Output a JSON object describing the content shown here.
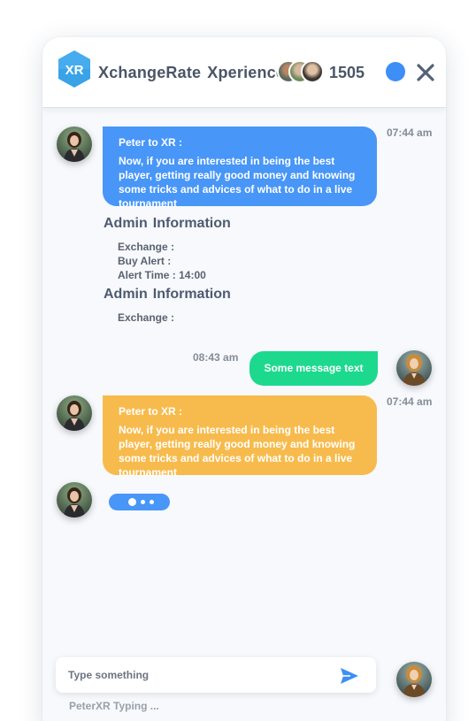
{
  "header": {
    "brand_word1": "XchangeRate",
    "brand_word2": "Xperience",
    "logo_text": "XR",
    "participant_count": "1505"
  },
  "messages": [
    {
      "sender": "Peter to XR :",
      "text": "Now, if you are interested in being the best player, getting really good money and knowing some tricks and advices of what to do in a live tournament",
      "time": "07:44 am"
    },
    {
      "text": "Some message text",
      "time": "08:43 am"
    },
    {
      "sender": "Peter to XR :",
      "text": "Now, if you are interested in being the best player, getting really good money and knowing some tricks and advices of what to do in a live tournament",
      "time": "07:44 am"
    }
  ],
  "admin_blocks": [
    {
      "title_word1": "Admin",
      "title_word2": "Information",
      "lines": [
        "Exchange :",
        "Buy Alert :",
        "Alert Time : 14:00"
      ]
    },
    {
      "title_word1": "Admin",
      "title_word2": "Information",
      "lines": [
        "Exchange :"
      ]
    }
  ],
  "composer": {
    "placeholder": "Type something",
    "typing_status": "PeterXR Typing ..."
  },
  "colors": {
    "accent_blue": "#4896f7",
    "status_blue": "#3d8ef6",
    "incoming_orange": "#f7bb4d",
    "outgoing_green": "#1dd98e"
  },
  "icons": {
    "logo": "xr-hexagon-logo",
    "close": "close-icon",
    "send": "send-icon",
    "status": "status-dot"
  }
}
